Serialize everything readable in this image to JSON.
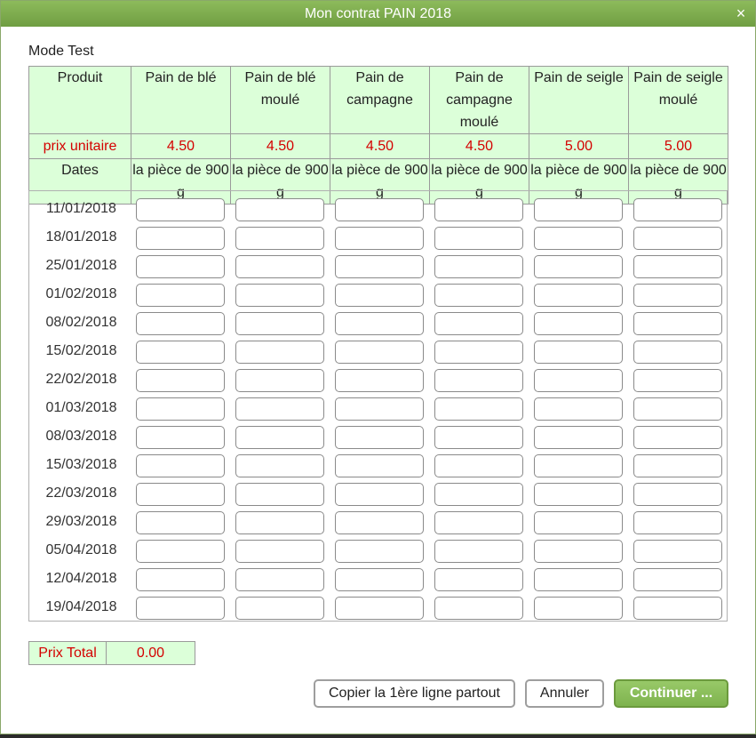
{
  "dialog": {
    "title": "Mon contrat PAIN 2018",
    "close": "×"
  },
  "mode": "Mode Test",
  "header": {
    "first_col": "Produit",
    "price_label": "prix unitaire",
    "dates_label": "Dates",
    "products": [
      {
        "name": "Pain de blé",
        "price": "4.50",
        "unit": "la pièce de 900 g"
      },
      {
        "name": "Pain de blé moulé",
        "price": "4.50",
        "unit": "la pièce de 900 g"
      },
      {
        "name": "Pain de campagne",
        "price": "4.50",
        "unit": "la pièce de 900 g"
      },
      {
        "name": "Pain de campagne moulé",
        "price": "4.50",
        "unit": "la pièce de 900 g"
      },
      {
        "name": "Pain de seigle",
        "price": "5.00",
        "unit": "la pièce de 900 g"
      },
      {
        "name": "Pain de seigle moulé",
        "price": "5.00",
        "unit": "la pièce de 900 g"
      }
    ]
  },
  "dates": [
    "11/01/2018",
    "18/01/2018",
    "25/01/2018",
    "01/02/2018",
    "08/02/2018",
    "15/02/2018",
    "22/02/2018",
    "01/03/2018",
    "08/03/2018",
    "15/03/2018",
    "22/03/2018",
    "29/03/2018",
    "05/04/2018",
    "12/04/2018",
    "19/04/2018"
  ],
  "total": {
    "label": "Prix Total",
    "value": "0.00"
  },
  "buttons": {
    "copy": "Copier la 1ère ligne partout",
    "cancel": "Annuler",
    "continue": "Continuer ..."
  },
  "colors": {
    "title_bar": "#7aab4b",
    "header_bg": "#dcffd9",
    "price_text": "#d40000",
    "continue_bg": "#88bd59"
  }
}
